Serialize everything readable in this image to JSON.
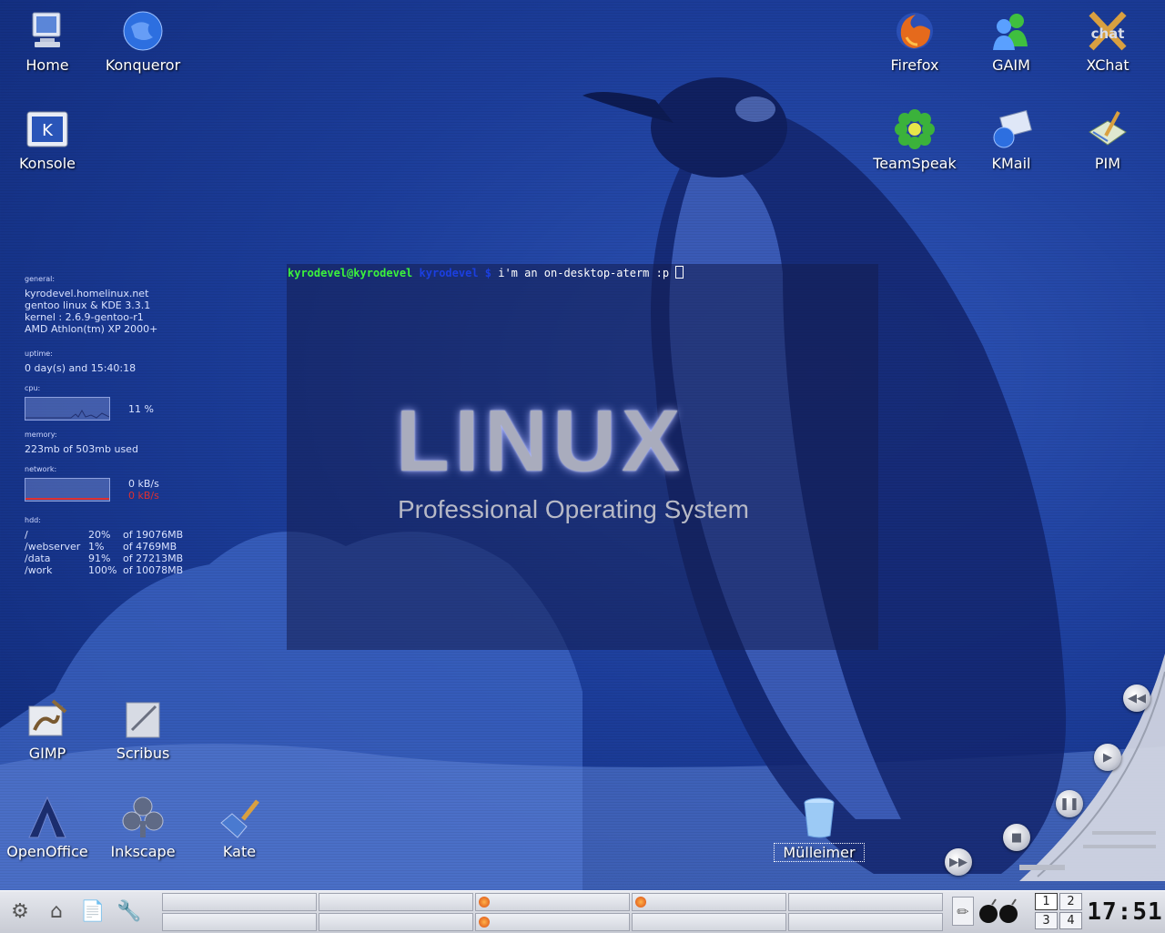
{
  "desktop": {
    "icons_left": [
      {
        "name": "home",
        "label": "Home"
      },
      {
        "name": "konqueror",
        "label": "Konqueror"
      },
      {
        "name": "konsole",
        "label": "Konsole"
      }
    ],
    "icons_right": [
      {
        "name": "firefox",
        "label": "Firefox"
      },
      {
        "name": "gaim",
        "label": "GAIM"
      },
      {
        "name": "xchat",
        "label": "XChat"
      },
      {
        "name": "teamspeak",
        "label": "TeamSpeak"
      },
      {
        "name": "kmail",
        "label": "KMail"
      },
      {
        "name": "pim",
        "label": "PIM"
      }
    ],
    "icons_bottom": [
      {
        "name": "gimp",
        "label": "GIMP"
      },
      {
        "name": "scribus",
        "label": "Scribus"
      },
      {
        "name": "openoffice",
        "label": "OpenOffice"
      },
      {
        "name": "inkscape",
        "label": "Inkscape"
      },
      {
        "name": "kate",
        "label": "Kate"
      }
    ],
    "trash": {
      "label": "Mülleimer"
    },
    "xchat_logo_text": "chat"
  },
  "sysinfo": {
    "general_label": "general:",
    "hostname": "kyrodevel.homelinux.net",
    "distro": "gentoo linux & KDE 3.3.1",
    "kernel": "kernel :  2.6.9-gentoo-r1",
    "cpu_model": "AMD Athlon(tm) XP 2000+",
    "uptime_label": "uptime:",
    "uptime": "0 day(s) and 15:40:18",
    "cpu_label": "cpu:",
    "cpu_value": "11 %",
    "memory_label": "memory:",
    "memory": "223mb of 503mb used",
    "network_label": "network:",
    "net_in": "0 kB/s",
    "net_out": "0 kB/s",
    "hdd_label": "hdd:",
    "hdd": [
      {
        "mount": "/",
        "pct": "20%",
        "size": "of 19076MB"
      },
      {
        "mount": "/webserver",
        "pct": "1%",
        "size": "of 4769MB"
      },
      {
        "mount": "/data",
        "pct": "91%",
        "size": "of 27213MB"
      },
      {
        "mount": "/work",
        "pct": "100%",
        "size": "of 10078MB"
      }
    ]
  },
  "terminal": {
    "user": "kyrodevel@kyrodevel",
    "dir": "kyrodevel $",
    "command": " i'm an on-desktop-aterm :p "
  },
  "wallpaper": {
    "title": "LINUX",
    "subtitle": "Professional Operating System"
  },
  "taskbar": {
    "pager": [
      "1",
      "2",
      "3",
      "4"
    ],
    "active_desktop": "1",
    "clock": "17:51"
  },
  "colors": {
    "terminal_user": "#3cf23c",
    "terminal_dir": "#1b3fe0",
    "net_out": "#e03030"
  }
}
